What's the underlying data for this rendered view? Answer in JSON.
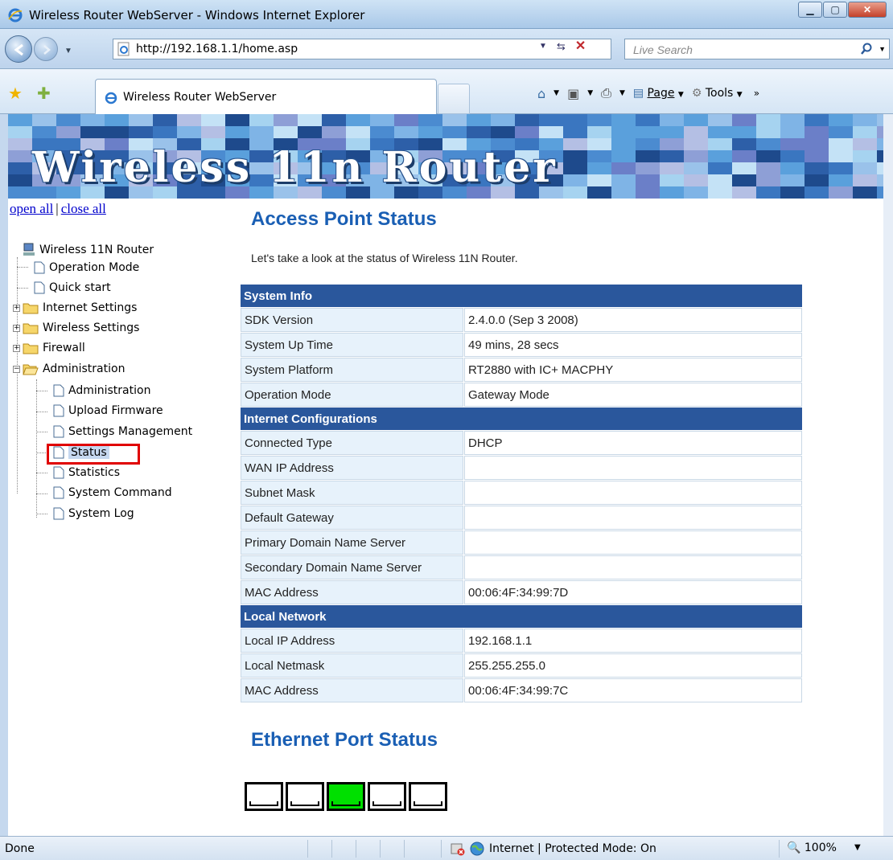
{
  "window": {
    "title": "Wireless Router WebServer - Windows Internet Explorer"
  },
  "address_bar": {
    "url": "http://192.168.1.1/home.asp",
    "search_placeholder": "Live Search"
  },
  "tabs": {
    "active_label": "Wireless Router WebServer"
  },
  "command_bar": {
    "page_label": "Page",
    "tools_label": "Tools"
  },
  "banner": {
    "brand": "Wireless 11n Router"
  },
  "sidebar": {
    "open_all": "open all",
    "separator": "|",
    "close_all": "close all",
    "root": "Wireless 11N Router",
    "items": [
      {
        "label": "Operation Mode",
        "type": "page"
      },
      {
        "label": "Quick start",
        "type": "page"
      },
      {
        "label": "Internet Settings",
        "type": "folder"
      },
      {
        "label": "Wireless Settings",
        "type": "folder"
      },
      {
        "label": "Firewall",
        "type": "folder"
      },
      {
        "label": "Administration",
        "type": "folder-open"
      }
    ],
    "admin_children": [
      "Administration",
      "Upload Firmware",
      "Settings Management",
      "Status",
      "Statistics",
      "System Command",
      "System Log"
    ],
    "selected": "Status"
  },
  "main": {
    "title": "Access Point Status",
    "intro": "Let's take a look at the status of Wireless 11N Router.",
    "sections": [
      {
        "header": "System Info",
        "rows": [
          {
            "label": "SDK Version",
            "value": "2.4.0.0 (Sep 3 2008)"
          },
          {
            "label": "System Up Time",
            "value": "49 mins, 28 secs"
          },
          {
            "label": "System Platform",
            "value": "RT2880 with IC+ MACPHY"
          },
          {
            "label": "Operation Mode",
            "value": "Gateway Mode"
          }
        ]
      },
      {
        "header": "Internet Configurations",
        "rows": [
          {
            "label": "Connected Type",
            "value": "DHCP"
          },
          {
            "label": "WAN IP Address",
            "value": ""
          },
          {
            "label": "Subnet Mask",
            "value": ""
          },
          {
            "label": "Default Gateway",
            "value": ""
          },
          {
            "label": "Primary Domain Name Server",
            "value": ""
          },
          {
            "label": "Secondary Domain Name Server",
            "value": ""
          },
          {
            "label": "MAC Address",
            "value": "00:06:4F:34:99:7D"
          }
        ]
      },
      {
        "header": "Local Network",
        "rows": [
          {
            "label": "Local IP Address",
            "value": "192.168.1.1"
          },
          {
            "label": "Local Netmask",
            "value": "255.255.255.0"
          },
          {
            "label": "MAC Address",
            "value": "00:06:4F:34:99:7C"
          }
        ]
      }
    ],
    "ethernet_title": "Ethernet Port Status",
    "ethernet_ports": [
      false,
      false,
      true,
      false,
      false
    ]
  },
  "statusbar": {
    "done": "Done",
    "zone": "Internet | Protected Mode: On",
    "zoom": "100%"
  },
  "colors": {
    "section_header": "#2a579c",
    "title_blue": "#1a5fb4",
    "port_active": "#00e000",
    "highlight_red": "#e00000"
  }
}
